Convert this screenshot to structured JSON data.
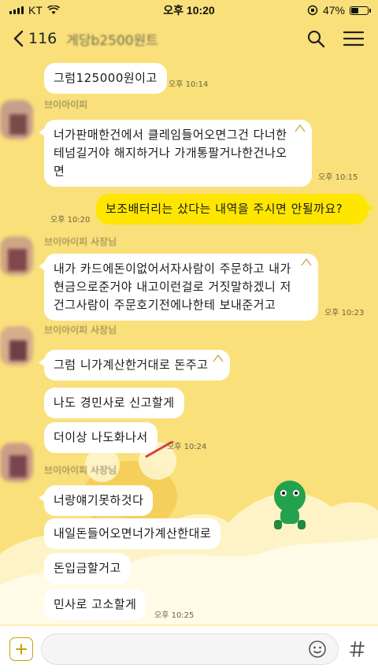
{
  "status_bar": {
    "carrier": "KT",
    "time": "오후 10:20",
    "battery_percent": "47%",
    "battery_level": 0.47
  },
  "header": {
    "back_count": "116",
    "title": "게당b2500원트",
    "search_icon": "search-icon",
    "menu_icon": "menu-icon"
  },
  "messages": [
    {
      "id": "m1",
      "side": "left",
      "text": "그럼125000원이고",
      "time": "오후 10:14"
    },
    {
      "id": "m2",
      "side": "left",
      "sender": "브이아이피",
      "text_lines": [
        "너가판매한건에서 클레임들어오면그건 다너한",
        "테넘길거야 해지하거나 가개통팔거나한건나오",
        "면"
      ],
      "time": "오후 10:15"
    },
    {
      "id": "m3",
      "side": "right",
      "text": "보조배터리는 샀다는 내역을 주시면 안될까요?",
      "time": "오후 10:20"
    },
    {
      "id": "m4",
      "side": "left",
      "sender": "브이아이피 사장님",
      "text_lines": [
        "내가 카드에돈이없어서자사람이 주문하고 내가",
        "현금으로준거야 내고이런걸로 거짓말하겠니 저",
        "건그사람이 주문호기전에나한테 보내준거고"
      ],
      "time": "오후 10:23"
    },
    {
      "id": "m5",
      "side": "left",
      "sender": "브이아이피 사장님",
      "text": "그럼 니가계산한거대로 돈주고"
    },
    {
      "id": "m6",
      "side": "left",
      "text": "나도 경민사로 신고할게"
    },
    {
      "id": "m7",
      "side": "left",
      "text": "더이상 나도화나서",
      "time": "오후 10:24"
    },
    {
      "id": "m8",
      "side": "left",
      "sender": "브이아이피 사장님",
      "text": "너랑얘기못하것다"
    },
    {
      "id": "m9",
      "side": "left",
      "text": "내일돈들어오면너가계산한대로"
    },
    {
      "id": "m10",
      "side": "left",
      "text": "돈입금할거고"
    },
    {
      "id": "m11",
      "side": "left",
      "text": "민사로 고소할게",
      "time": "오후 10:25"
    }
  ],
  "input_bar": {
    "placeholder": "",
    "plus_icon": "plus-icon",
    "emoji_icon": "emoji-icon",
    "hash_icon": "hash-icon"
  },
  "colors": {
    "background": "#f9e07a",
    "my_bubble": "#fee600",
    "their_bubble": "#ffffff",
    "accent": "#c9a000"
  }
}
